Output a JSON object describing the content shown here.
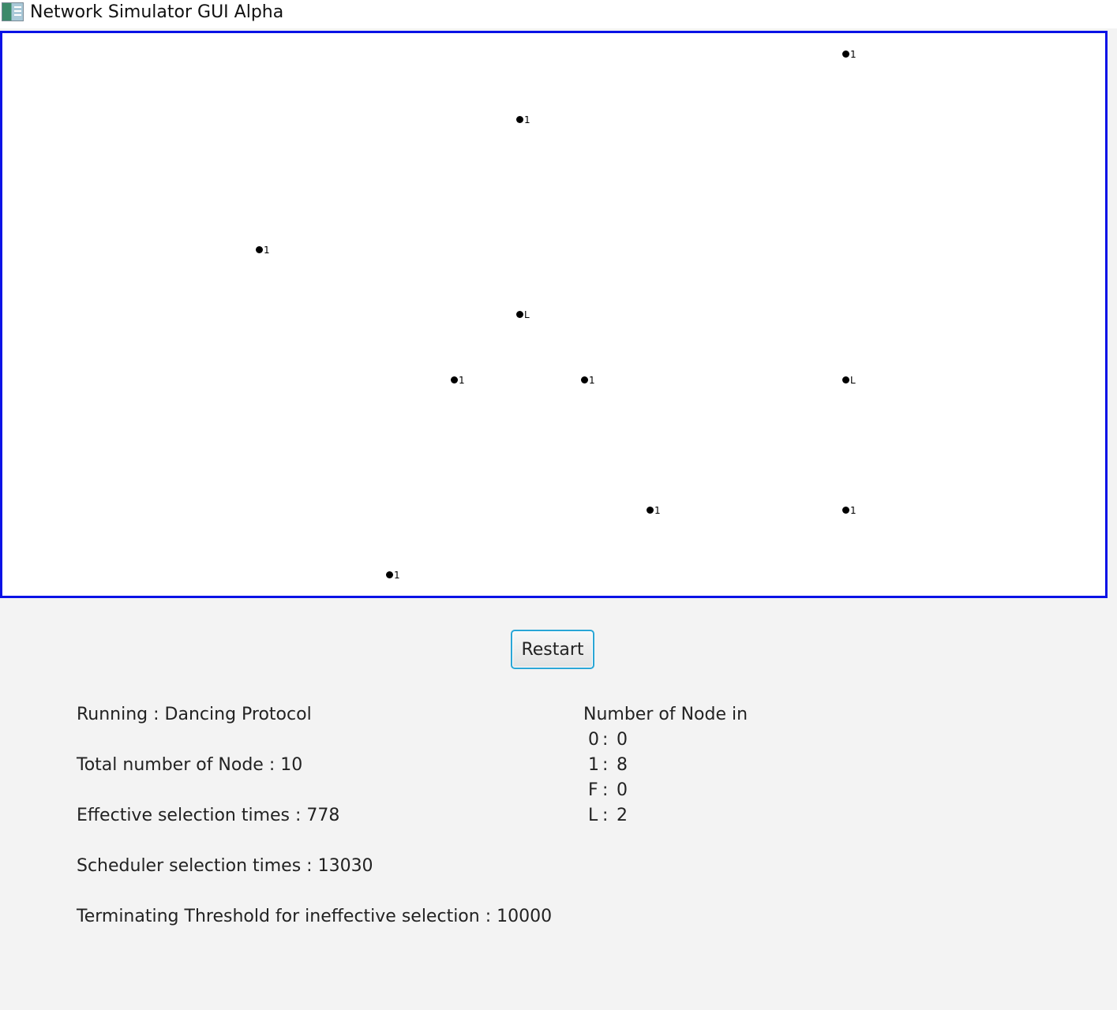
{
  "window": {
    "title": "Network Simulator GUI Alpha",
    "icon": "app-window-icon"
  },
  "canvas": {
    "border_color": "#0a12e6",
    "nodes": [
      {
        "label": "1"
      },
      {
        "label": "1"
      },
      {
        "label": "1"
      },
      {
        "label": "L"
      },
      {
        "label": "1"
      },
      {
        "label": "1"
      },
      {
        "label": "L"
      },
      {
        "label": "1"
      },
      {
        "label": "1"
      },
      {
        "label": "1"
      }
    ]
  },
  "controls": {
    "restart_label": "Restart"
  },
  "stats": {
    "running": "Running : Dancing Protocol",
    "total_nodes": "Total number of Node : 10",
    "effective_selection": "Effective selection times :  778",
    "scheduler_selection": "Scheduler selection times :  13030",
    "threshold": "Terminating Threshold for ineffective selection : 10000"
  },
  "node_counts": {
    "heading": "Number of Node in",
    "rows": [
      {
        "state": "0",
        "sep": ":",
        "count": "0"
      },
      {
        "state": "1",
        "sep": ":",
        "count": "8"
      },
      {
        "state": "F",
        "sep": ":",
        "count": "0"
      },
      {
        "state": "L",
        "sep": ":",
        "count": "2"
      }
    ]
  }
}
